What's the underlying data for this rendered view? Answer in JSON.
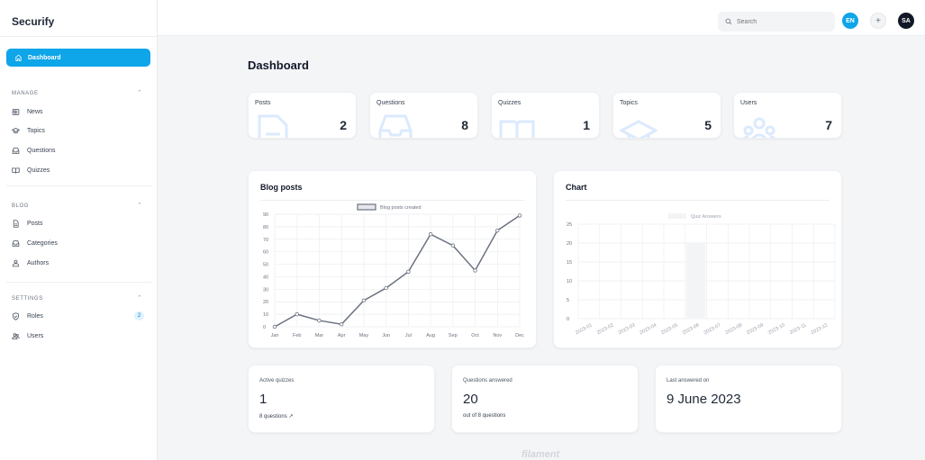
{
  "app": {
    "brand": "Securify"
  },
  "sidebar": {
    "active": {
      "label": "Dashboard",
      "icon": "home-icon"
    },
    "groups": [
      {
        "title": "MANAGE",
        "items": [
          {
            "label": "News",
            "icon": "newspaper-icon"
          },
          {
            "label": "Topics",
            "icon": "graduation-cap-icon"
          },
          {
            "label": "Questions",
            "icon": "inbox-icon"
          },
          {
            "label": "Quizzes",
            "icon": "book-open-icon"
          }
        ]
      },
      {
        "title": "BLOG",
        "items": [
          {
            "label": "Posts",
            "icon": "document-icon"
          },
          {
            "label": "Categories",
            "icon": "inbox-icon"
          },
          {
            "label": "Authors",
            "icon": "user-group-icon"
          }
        ]
      },
      {
        "title": "SETTINGS",
        "items": [
          {
            "label": "Roles",
            "icon": "shield-check-icon",
            "badge": "2"
          },
          {
            "label": "Users",
            "icon": "users-icon"
          }
        ]
      }
    ]
  },
  "topbar": {
    "search_placeholder": "Search",
    "lang": "EN",
    "add": "+",
    "avatar": "SA"
  },
  "page": {
    "title": "Dashboard"
  },
  "stats": [
    {
      "label": "Posts",
      "value": "2",
      "icon": "document-icon"
    },
    {
      "label": "Questions",
      "value": "8",
      "icon": "inbox-icon"
    },
    {
      "label": "Quizzes",
      "value": "1",
      "icon": "book-open-icon"
    },
    {
      "label": "Topics",
      "value": "5",
      "icon": "graduation-cap-icon"
    },
    {
      "label": "Users",
      "value": "7",
      "icon": "user-group-icon"
    }
  ],
  "chart_data": [
    {
      "type": "line",
      "title": "Blog posts",
      "legend": "Blog posts created",
      "categories": [
        "Jan",
        "Feb",
        "Mar",
        "Apr",
        "May",
        "Jun",
        "Jul",
        "Aug",
        "Sep",
        "Oct",
        "Nov",
        "Dec"
      ],
      "values": [
        0,
        10,
        5,
        2,
        21,
        31,
        44,
        74,
        65,
        45,
        77,
        89
      ],
      "y_ticks": [
        "90",
        "80",
        "70",
        "60",
        "50",
        "40",
        "30",
        "20",
        "10",
        "0"
      ],
      "ylim": [
        0,
        90
      ],
      "grid": true,
      "legend_position": "top",
      "color": "#6b7280"
    },
    {
      "type": "bar",
      "title": "Chart",
      "legend": "Quiz Answers",
      "categories": [
        "2023-01",
        "2023-02",
        "2023-03",
        "2023-04",
        "2023-05",
        "2023-06",
        "2023-07",
        "2023-08",
        "2023-09",
        "2023-10",
        "2023-11",
        "2023-12"
      ],
      "values": [
        0,
        0,
        0,
        0,
        0,
        20,
        0,
        0,
        0,
        0,
        0,
        0
      ],
      "y_ticks": [
        "25",
        "20",
        "15",
        "10",
        "5",
        "0"
      ],
      "ylim": [
        0,
        25
      ],
      "grid": true,
      "legend_position": "top",
      "color": "#f3f4f6"
    }
  ],
  "summary": [
    {
      "label": "Active quizzes",
      "value": "1",
      "description": "8 questions ↗"
    },
    {
      "label": "Questions answered",
      "value": "20",
      "description": "out of 8 questions"
    },
    {
      "label": "Last answered on",
      "value": "9 June 2023",
      "description": ""
    }
  ],
  "footer": {
    "logo": "filament"
  },
  "colors": {
    "accent": "#0ea5e9",
    "avatar": "#111827"
  }
}
